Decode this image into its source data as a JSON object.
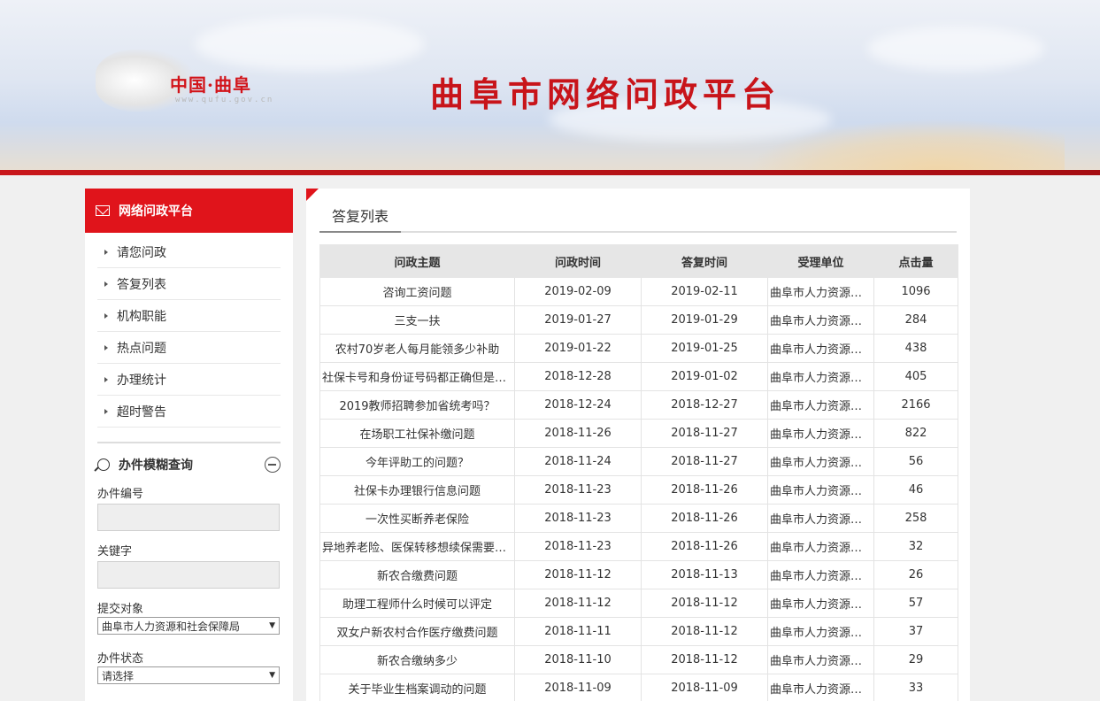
{
  "header": {
    "logo_text": "中国·曲阜",
    "logo_url_text": "www.qufu.gov.cn",
    "site_title": "曲阜市网络问政平台"
  },
  "colors": {
    "brand_red": "#e0141b",
    "title_red": "#c8141a"
  },
  "sidebar": {
    "head_title": "网络问政平台",
    "head_icon": "mail-icon",
    "items": [
      {
        "label": "请您问政"
      },
      {
        "label": "答复列表"
      },
      {
        "label": "机构职能"
      },
      {
        "label": "热点问题"
      },
      {
        "label": "办理统计"
      },
      {
        "label": "超时警告"
      }
    ],
    "search": {
      "title": "办件模糊查询",
      "fields": {
        "case_no_label": "办件编号",
        "case_no_value": "",
        "keyword_label": "关键字",
        "keyword_value": "",
        "target_label": "提交对象",
        "target_value": "曲阜市人力资源和社会保障局",
        "status_label": "办件状态",
        "status_value": "请选择"
      }
    }
  },
  "main": {
    "tab_title": "答复列表",
    "columns": [
      "问政主题",
      "问政时间",
      "答复时间",
      "受理单位",
      "点击量"
    ],
    "rows": [
      [
        "咨询工资问题",
        "2019-02-09",
        "2019-02-11",
        "曲阜市人力资源和...",
        "1096"
      ],
      [
        "三支一扶",
        "2019-01-27",
        "2019-01-29",
        "曲阜市人力资源和...",
        "284"
      ],
      [
        "农村70岁老人每月能领多少补助",
        "2019-01-22",
        "2019-01-25",
        "曲阜市人力资源和...",
        "438"
      ],
      [
        "社保卡号和身份证号码都正确但是绑...",
        "2018-12-28",
        "2019-01-02",
        "曲阜市人力资源和...",
        "405"
      ],
      [
        "2019教师招聘参加省统考吗？",
        "2018-12-24",
        "2018-12-27",
        "曲阜市人力资源和...",
        "2166"
      ],
      [
        "在场职工社保补缴问题",
        "2018-11-26",
        "2018-11-27",
        "曲阜市人力资源和...",
        "822"
      ],
      [
        "今年评助工的问题？",
        "2018-11-24",
        "2018-11-27",
        "曲阜市人力资源和...",
        "56"
      ],
      [
        "社保卡办理银行信息问题",
        "2018-11-23",
        "2018-11-26",
        "曲阜市人力资源和...",
        "46"
      ],
      [
        "一次性买断养老保险",
        "2018-11-23",
        "2018-11-26",
        "曲阜市人力资源和...",
        "258"
      ],
      [
        "异地养老险、医保转移想续保需要哪...",
        "2018-11-23",
        "2018-11-26",
        "曲阜市人力资源和...",
        "32"
      ],
      [
        "新农合缴费问题",
        "2018-11-12",
        "2018-11-13",
        "曲阜市人力资源和...",
        "26"
      ],
      [
        "助理工程师什么时候可以评定",
        "2018-11-12",
        "2018-11-12",
        "曲阜市人力资源和...",
        "57"
      ],
      [
        "双女户新农村合作医疗缴费问题",
        "2018-11-11",
        "2018-11-12",
        "曲阜市人力资源和...",
        "37"
      ],
      [
        "新农合缴纳多少",
        "2018-11-10",
        "2018-11-12",
        "曲阜市人力资源和...",
        "29"
      ],
      [
        "关于毕业生档案调动的问题",
        "2018-11-09",
        "2018-11-09",
        "曲阜市人力资源和...",
        "33"
      ]
    ]
  }
}
